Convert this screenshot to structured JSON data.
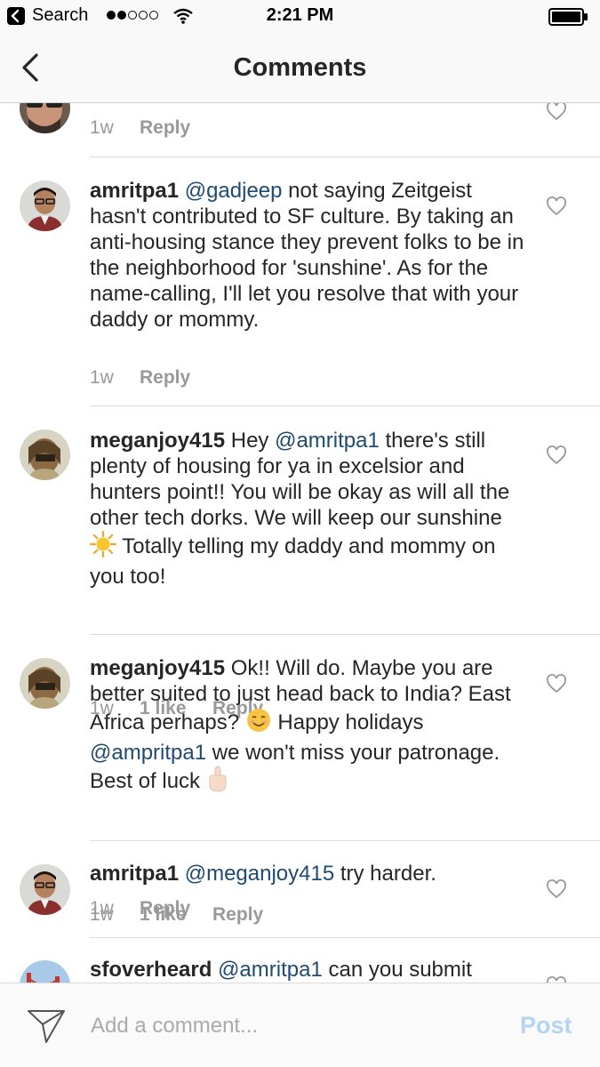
{
  "status_bar": {
    "back_app": "Search",
    "time": "2:21 PM",
    "signal_bars_filled": 2,
    "signal_bars_total": 5
  },
  "nav": {
    "title": "Comments",
    "back_icon": "chevron-left-icon"
  },
  "comments": [
    {
      "user": "",
      "text_parts": [],
      "time": "1w",
      "likes": "",
      "reply": "Reply"
    },
    {
      "user": "amritpa1",
      "mention": "@gadjeep",
      "text": " not saying Zeitgeist hasn't contributed to SF culture. By taking an anti-housing stance they prevent folks to be in the neighborhood for 'sunshine'. As for the name-calling, I'll let you resolve that with your daddy or mommy.",
      "time": "1w",
      "likes": "",
      "reply": "Reply"
    },
    {
      "user": "meganjoy415",
      "pre": " Hey ",
      "mention": "@amritpa1",
      "text": " there's still plenty of housing for ya in excelsior and hunters point!! You will be okay as will all the other tech dorks. We will keep our sunshine ",
      "emoji": "sun-emoji",
      "text2": "  Totally telling my daddy and mommy on you too!",
      "time": "1w",
      "likes": "1 like",
      "reply": "Reply"
    },
    {
      "user": "meganjoy415",
      "text": " Ok!! Will do. Maybe you are better suited to just head back to India? East Africa perhaps? ",
      "emoji": "smiling-face-emoji",
      "text2": " Happy holidays ",
      "mention": "@ampritpa1",
      "text3": " we won't miss your patronage. Best of luck ",
      "emoji2": "middle-finger-emoji",
      "time": "1w",
      "likes": "1 like",
      "reply": "Reply"
    },
    {
      "user": "amritpa1",
      "mention": "@meganjoy415",
      "text": " try harder.",
      "time": "1w",
      "likes": "",
      "reply": "Reply"
    },
    {
      "user": "sfoverheard",
      "mention": "@amritpa1",
      "text": " can you submit",
      "time": "",
      "likes": "",
      "reply": ""
    }
  ],
  "composer": {
    "placeholder": "Add a comment...",
    "post_label": "Post",
    "icon": "send-icon"
  },
  "colors": {
    "mention": "#1f4a73",
    "meta": "#999999",
    "post_disabled": "#b3d4f5",
    "bar_bg": "#f9f9f9"
  }
}
